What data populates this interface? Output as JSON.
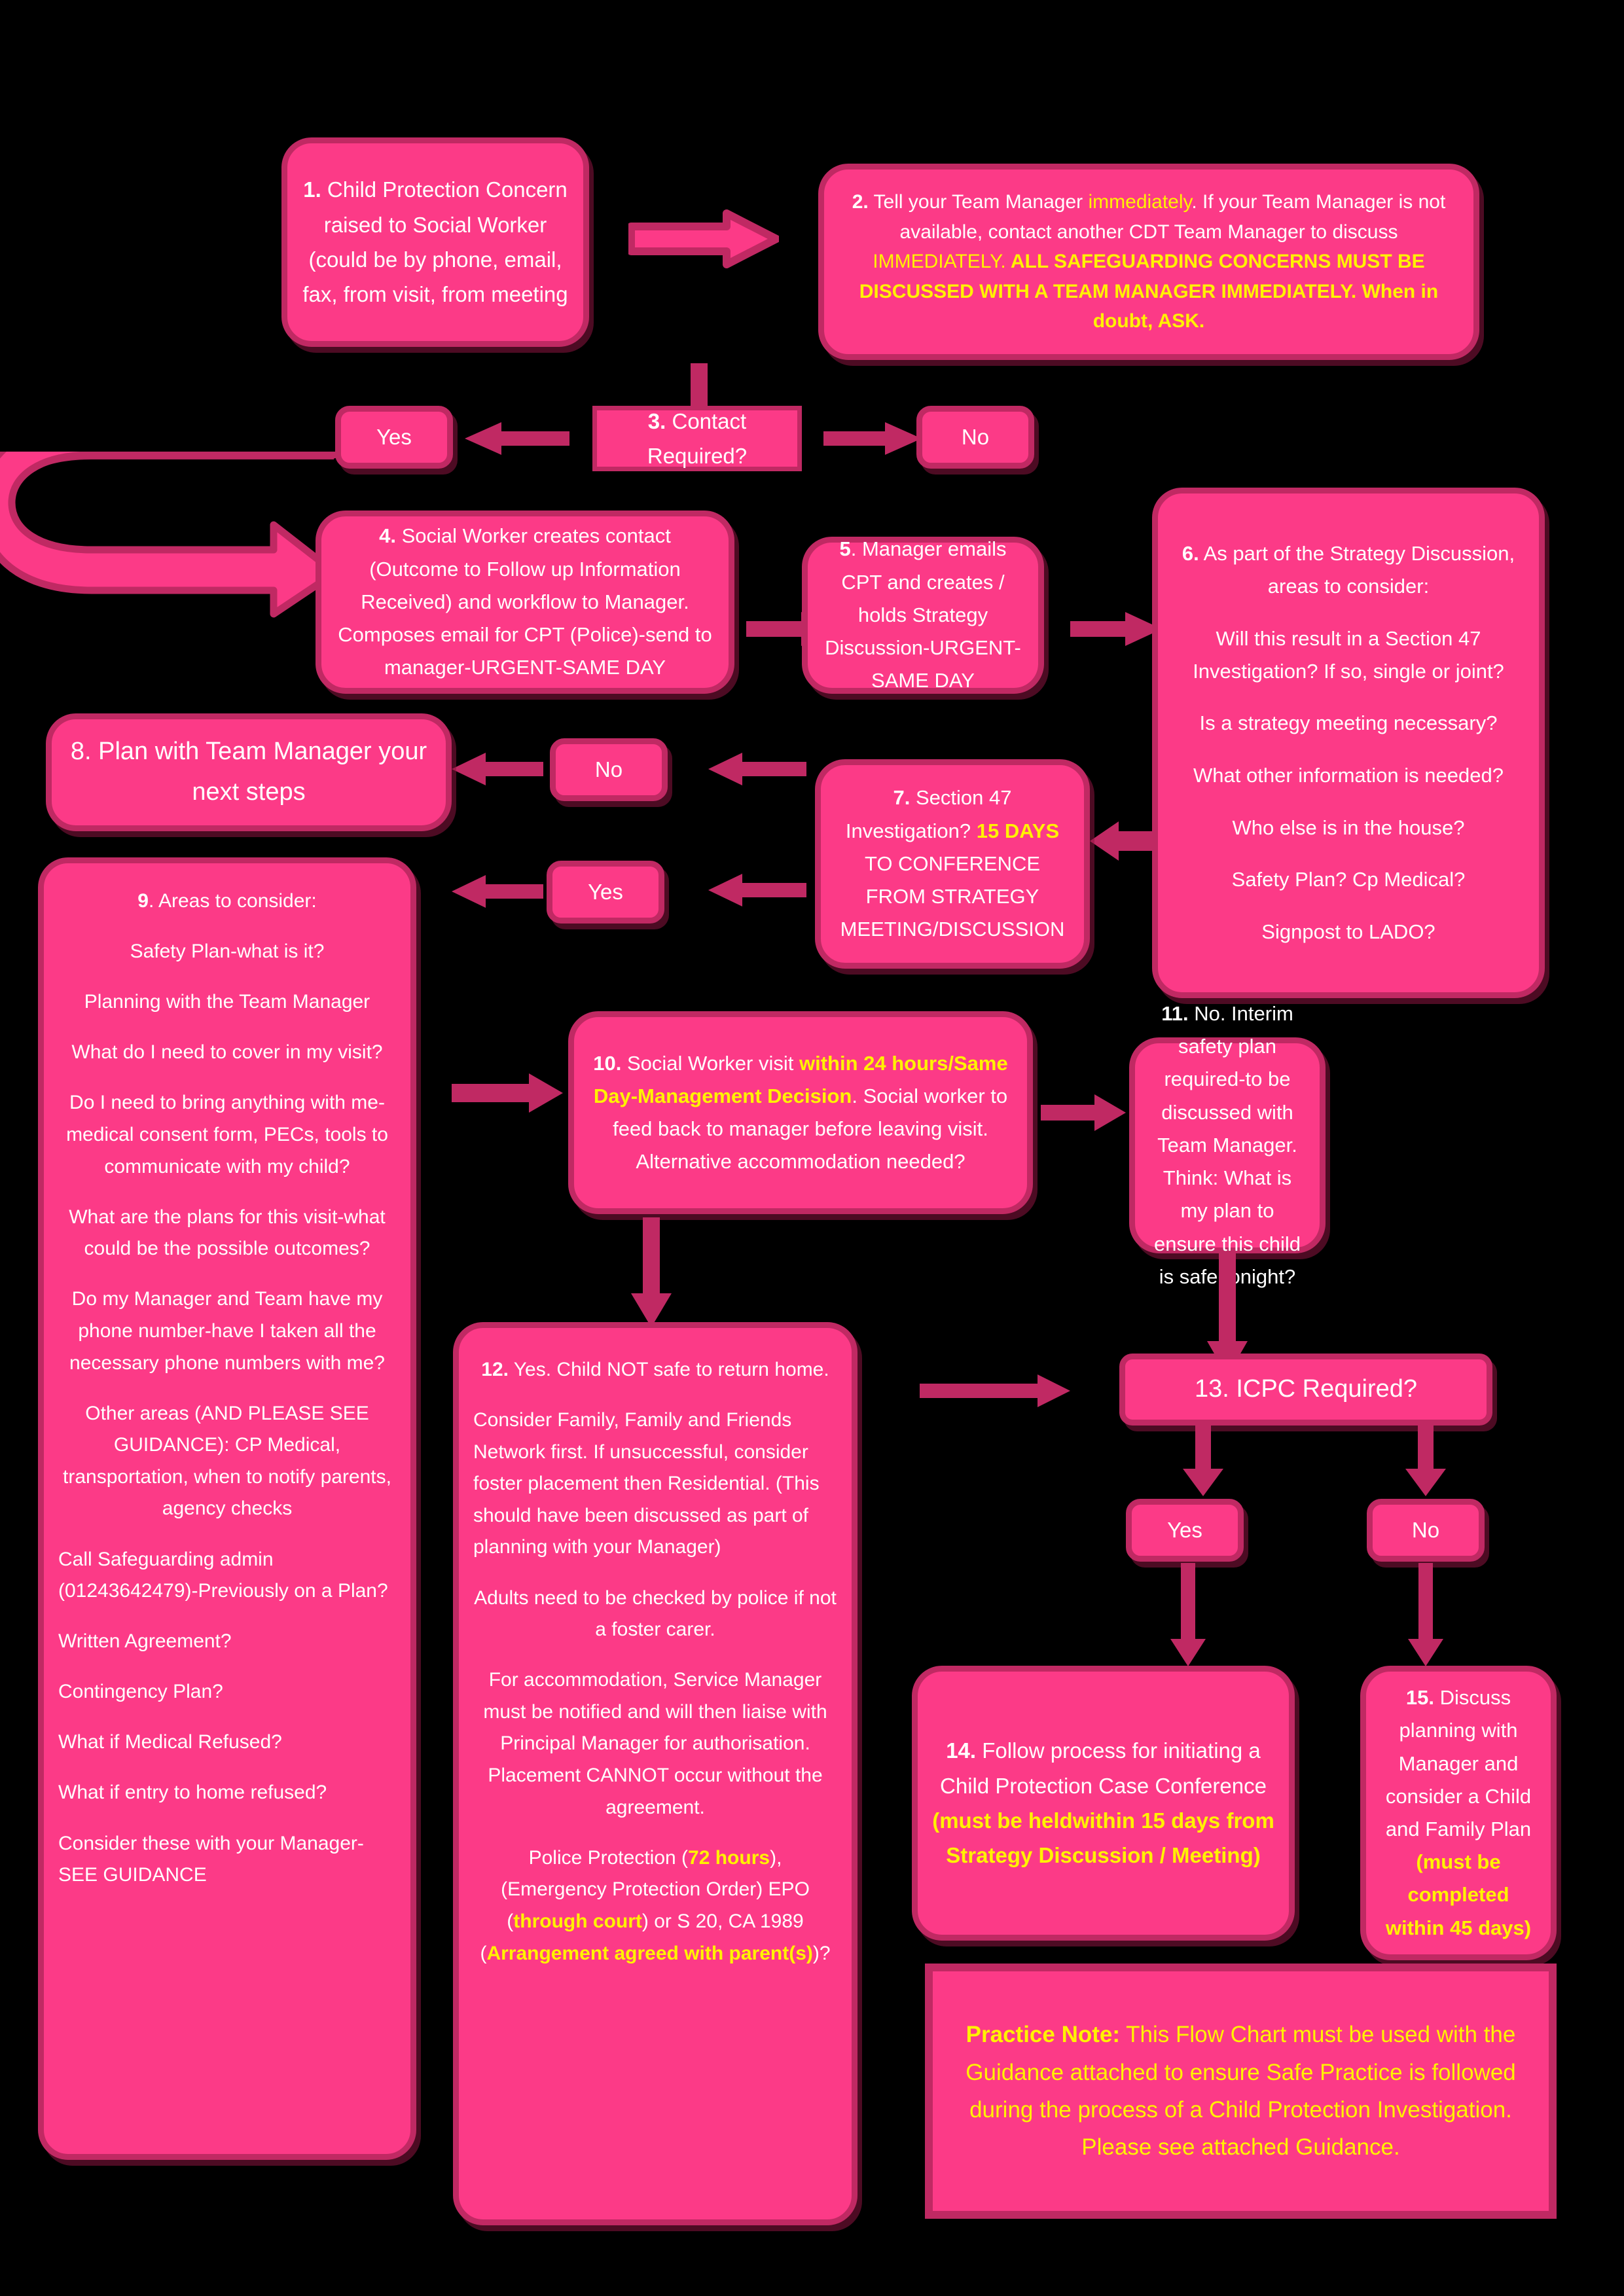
{
  "colors": {
    "background": "#000000",
    "box_fill": "#FC3A87",
    "box_border": "#C02963",
    "text": "#FFFFFF",
    "highlight": "#FFF200"
  },
  "nodes": {
    "n1": {
      "number": "1.",
      "text": "Child Protection Concern raised to Social Worker (could be by phone, email, fax, from visit, from meeting"
    },
    "n2": {
      "number": "2.",
      "seg1": " Tell your Team Manager ",
      "seg2_hl": "immediately",
      "seg3": ".  If your Team Manager is not available, contact another CDT Team Manager to discuss ",
      "seg4_hl": "IMMEDIATELY.",
      "seg5_hlb": " ALL SAFEGUARDING CONCERNS MUST BE DISCUSSED WITH A TEAM MANAGER IMMEDIATELY.  When in doubt, ASK."
    },
    "n3": {
      "number": "3.",
      "text": " Contact Required?"
    },
    "n3_yes": {
      "label": "Yes"
    },
    "n3_no": {
      "label": "No"
    },
    "n4": {
      "number": "4.",
      "text": " Social Worker creates  contact (Outcome to Follow up Information Received) and workflow to Manager. Composes email for CPT (Police)-send to manager-URGENT-SAME DAY"
    },
    "n5": {
      "number": "5",
      "text": ". Manager emails CPT and creates / holds Strategy Discussion-URGENT-SAME DAY"
    },
    "n6": {
      "number": "6.",
      "intro": " As part of the Strategy Discussion, areas to consider:",
      "items": [
        "Will this result in a Section 47 Investigation?  If so, single or joint?",
        "Is a strategy meeting necessary?",
        "What other information is needed?",
        "Who else is in the house?",
        "Safety Plan?  Cp Medical?",
        "Signpost to LADO?"
      ]
    },
    "n7": {
      "number": "7.",
      "seg1": " Section 47 Investigation? ",
      "seg2_hlb": "15 DAYS",
      "seg3": " TO CONFERENCE FROM STRATEGY MEETING/DISCUSSION"
    },
    "n7_no": {
      "label": "No"
    },
    "n7_yes": {
      "label": "Yes"
    },
    "n8": {
      "number": "8.",
      "text": " Plan with Team Manager your next steps"
    },
    "n9": {
      "number": "9",
      "intro": ". Areas to consider:",
      "items": [
        "Safety Plan-what is it?",
        "Planning with the Team Manager",
        "What do I need to cover in my visit?",
        "Do I need to bring anything with me-medical consent form, PECs, tools to communicate with my child?",
        "What are the plans for this visit-what could be the possible outcomes?",
        "Do my Manager and Team have my phone number-have I taken all the necessary phone numbers with me?",
        "Other areas (AND PLEASE SEE GUIDANCE):  CP Medical, transportation, when to notify parents, agency checks"
      ],
      "items_left": [
        "Call Safeguarding admin (01243642479)-Previously on a Plan?",
        "Written Agreement?",
        "Contingency Plan?",
        "What if Medical Refused?",
        "What if entry to home refused?",
        "Consider these with your Manager-SEE GUIDANCE"
      ]
    },
    "n10": {
      "number": "10.",
      "seg1": " Social Worker visit ",
      "seg2_hlb": "within 24 hours/Same Day-Management Decision",
      "seg3": ". Social worker to feed back to manager before leaving visit. Alternative accommodation needed?"
    },
    "n11": {
      "number": "11.",
      "text": " No.  Interim safety plan required-to be discussed with Team Manager. Think: What is my plan to ensure this child is safe tonight?"
    },
    "n12": {
      "number": "12.",
      "para1": " Yes.  Child NOT safe to return home.",
      "para2": "Consider Family, Family and Friends Network first.  If unsuccessful, consider foster placement then Residential. (This should have been discussed as part of planning with your Manager)",
      "para3": "Adults need to be checked by police if not a foster carer.",
      "para4": "For accommodation, Service Manager must be notified and will then liaise with Principal Manager for authorisation. Placement CANNOT occur without the agreement.",
      "para5_a": "Police Protection (",
      "para5_hlb1": "72 hours",
      "para5_b": "), (Emergency Protection Order) EPO (",
      "para5_hlb2": "through court",
      "para5_c": ") or S 20, CA 1989 (",
      "para5_hlb3": "Arrangement agreed with parent(s)",
      "para5_d": ")?"
    },
    "n13": {
      "number": "13.",
      "text": " ICPC Required?"
    },
    "n13_yes": {
      "label": "Yes"
    },
    "n13_no": {
      "label": "No"
    },
    "n14": {
      "number": "14.",
      "seg1": " Follow process for initiating a Child Protection Case Conference ",
      "seg2_hlb": "(must be heldwithin 15 days from Strategy Discussion / Meeting)"
    },
    "n15": {
      "number": "15.",
      "seg1": " Discuss planning with Manager and consider a Child and Family Plan ",
      "seg2_hlb": "(must be completed within 45 days)"
    },
    "practice_note": {
      "label": "Practice Note:",
      "text": "  This Flow Chart must be used with the Guidance attached to ensure Safe Practice is followed during the process of a Child Protection Investigation.  Please see attached Guidance."
    }
  },
  "arrows": [
    {
      "name": "arrow-1-to-2",
      "dir": "right"
    },
    {
      "name": "arrow-1-to-3",
      "dir": "down"
    },
    {
      "name": "arrow-3-to-yes",
      "dir": "left"
    },
    {
      "name": "arrow-3-to-no",
      "dir": "right"
    },
    {
      "name": "arrow-yes-loop-to-4",
      "dir": "uturn"
    },
    {
      "name": "arrow-4-to-5",
      "dir": "right"
    },
    {
      "name": "arrow-5-to-6",
      "dir": "right"
    },
    {
      "name": "arrow-6-to-7",
      "dir": "left"
    },
    {
      "name": "arrow-7-to-no",
      "dir": "left"
    },
    {
      "name": "arrow-no-to-8",
      "dir": "left"
    },
    {
      "name": "arrow-7-to-yes",
      "dir": "left"
    },
    {
      "name": "arrow-yes-to-9",
      "dir": "left"
    },
    {
      "name": "arrow-9-to-10",
      "dir": "right"
    },
    {
      "name": "arrow-10-to-11",
      "dir": "right"
    },
    {
      "name": "arrow-10-to-12",
      "dir": "down"
    },
    {
      "name": "arrow-11-to-13",
      "dir": "down"
    },
    {
      "name": "arrow-12-to-13",
      "dir": "right"
    },
    {
      "name": "arrow-13-to-yes",
      "dir": "down"
    },
    {
      "name": "arrow-13-to-no",
      "dir": "down"
    },
    {
      "name": "arrow-yes-to-14",
      "dir": "down"
    },
    {
      "name": "arrow-no-to-15",
      "dir": "down"
    }
  ]
}
